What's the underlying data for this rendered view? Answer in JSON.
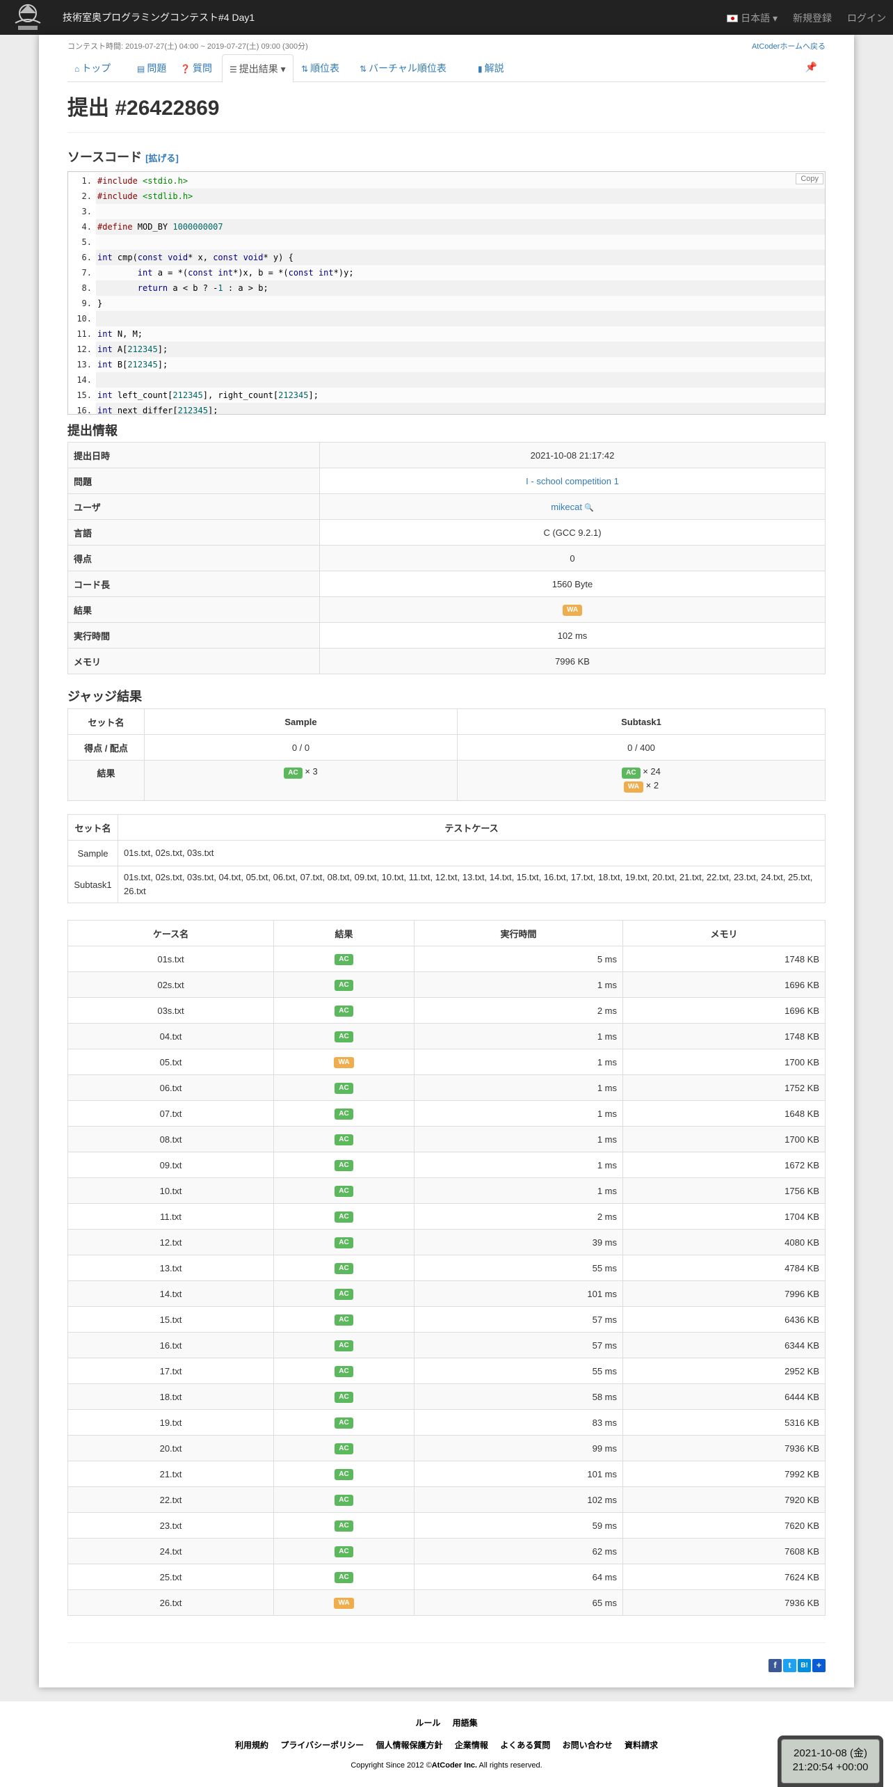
{
  "navbar": {
    "contest_title": "技術室奥プログラミングコンテスト#4 Day1",
    "language": "日本語",
    "signup": "新規登録",
    "login": "ログイン"
  },
  "header": {
    "contest_time": "コンテスト時間: 2019-07-27(土) 04:00 ~ 2019-07-27(土) 09:00 (300分)",
    "home_link": "AtCoderホームへ戻る"
  },
  "tabs": [
    {
      "icon": "home-icon",
      "label": "トップ"
    },
    {
      "icon": "tasks-icon",
      "label": "問題"
    },
    {
      "icon": "question-icon",
      "label": "質問"
    },
    {
      "icon": "list-icon",
      "label": "提出結果"
    },
    {
      "icon": "sort-icon",
      "label": "順位表"
    },
    {
      "icon": "sort-icon",
      "label": "バーチャル順位表"
    },
    {
      "icon": "book-icon",
      "label": "解説"
    }
  ],
  "submission_title": "提出 #26422869",
  "source": {
    "title": "ソースコード",
    "expand": "[拡げる]",
    "copy": "Copy",
    "lines": [
      "#include <stdio.h>",
      "#include <stdlib.h>",
      "",
      "#define MOD_BY 1000000007",
      "",
      "int cmp(const void* x, const void* y) {",
      "\tint a = *(const int*)x, b = *(const int*)y;",
      "\treturn a < b ? -1 : a > b;",
      "}",
      "",
      "int N, M;",
      "int A[212345];",
      "int B[212345];",
      "",
      "int left_count[212345], right_count[212345];",
      "int next_differ[212345];"
    ]
  },
  "info": {
    "title": "提出情報",
    "rows": [
      {
        "key": "提出日時",
        "value": "2021-10-08 21:17:42"
      },
      {
        "key": "問題",
        "value": "I - school competition 1"
      },
      {
        "key": "ユーザ",
        "value": "mikecat"
      },
      {
        "key": "言語",
        "value": "C (GCC 9.2.1)"
      },
      {
        "key": "得点",
        "value": "0"
      },
      {
        "key": "コード長",
        "value": "1560 Byte"
      },
      {
        "key": "結果",
        "value": "WA"
      },
      {
        "key": "実行時間",
        "value": "102 ms"
      },
      {
        "key": "メモリ",
        "value": "7996 KB"
      }
    ]
  },
  "judge": {
    "title": "ジャッジ結果",
    "set_name": "セット名",
    "score_label": "得点 / 配点",
    "result_label": "結果",
    "sets": [
      {
        "name": "Sample",
        "score": "0 / 0",
        "results": [
          {
            "status": "AC",
            "count": "× 3"
          }
        ]
      },
      {
        "name": "Subtask1",
        "score": "0 / 400",
        "results": [
          {
            "status": "AC",
            "count": "× 24"
          },
          {
            "status": "WA",
            "count": "× 2"
          }
        ]
      }
    ]
  },
  "testcase_sets": {
    "col_set": "セット名",
    "col_cases": "テストケース",
    "rows": [
      {
        "name": "Sample",
        "files": "01s.txt, 02s.txt, 03s.txt"
      },
      {
        "name": "Subtask1",
        "files": "01s.txt, 02s.txt, 03s.txt, 04.txt, 05.txt, 06.txt, 07.txt, 08.txt, 09.txt, 10.txt, 11.txt, 12.txt, 13.txt, 14.txt, 15.txt, 16.txt, 17.txt, 18.txt, 19.txt, 20.txt, 21.txt, 22.txt, 23.txt, 24.txt, 25.txt, 26.txt"
      }
    ]
  },
  "cases": {
    "headers": [
      "ケース名",
      "結果",
      "実行時間",
      "メモリ"
    ],
    "rows": [
      [
        "01s.txt",
        "AC",
        "5 ms",
        "1748 KB"
      ],
      [
        "02s.txt",
        "AC",
        "1 ms",
        "1696 KB"
      ],
      [
        "03s.txt",
        "AC",
        "2 ms",
        "1696 KB"
      ],
      [
        "04.txt",
        "AC",
        "1 ms",
        "1748 KB"
      ],
      [
        "05.txt",
        "WA",
        "1 ms",
        "1700 KB"
      ],
      [
        "06.txt",
        "AC",
        "1 ms",
        "1752 KB"
      ],
      [
        "07.txt",
        "AC",
        "1 ms",
        "1648 KB"
      ],
      [
        "08.txt",
        "AC",
        "1 ms",
        "1700 KB"
      ],
      [
        "09.txt",
        "AC",
        "1 ms",
        "1672 KB"
      ],
      [
        "10.txt",
        "AC",
        "1 ms",
        "1756 KB"
      ],
      [
        "11.txt",
        "AC",
        "2 ms",
        "1704 KB"
      ],
      [
        "12.txt",
        "AC",
        "39 ms",
        "4080 KB"
      ],
      [
        "13.txt",
        "AC",
        "55 ms",
        "4784 KB"
      ],
      [
        "14.txt",
        "AC",
        "101 ms",
        "7996 KB"
      ],
      [
        "15.txt",
        "AC",
        "57 ms",
        "6436 KB"
      ],
      [
        "16.txt",
        "AC",
        "57 ms",
        "6344 KB"
      ],
      [
        "17.txt",
        "AC",
        "55 ms",
        "2952 KB"
      ],
      [
        "18.txt",
        "AC",
        "58 ms",
        "6444 KB"
      ],
      [
        "19.txt",
        "AC",
        "83 ms",
        "5316 KB"
      ],
      [
        "20.txt",
        "AC",
        "99 ms",
        "7936 KB"
      ],
      [
        "21.txt",
        "AC",
        "101 ms",
        "7992 KB"
      ],
      [
        "22.txt",
        "AC",
        "102 ms",
        "7920 KB"
      ],
      [
        "23.txt",
        "AC",
        "59 ms",
        "7620 KB"
      ],
      [
        "24.txt",
        "AC",
        "62 ms",
        "7608 KB"
      ],
      [
        "25.txt",
        "AC",
        "64 ms",
        "7624 KB"
      ],
      [
        "26.txt",
        "WA",
        "65 ms",
        "7936 KB"
      ]
    ]
  },
  "footer": {
    "row1": [
      "ルール",
      "用語集"
    ],
    "row2": [
      "利用規約",
      "プライバシーポリシー",
      "個人情報保護方針",
      "企業情報",
      "よくある質問",
      "お問い合わせ",
      "資料請求"
    ],
    "copyright_prefix": "Copyright Since 2012 ©",
    "copyright_company": "AtCoder Inc.",
    "copyright_suffix": " All rights reserved."
  },
  "clock": {
    "date": "2021-10-08 (金)",
    "time": "21:20:54 +00:00"
  },
  "colors": {
    "ac": "#5cb85c",
    "wa": "#f0ad4e",
    "link": "#337ab7",
    "navbar": "#222222"
  }
}
